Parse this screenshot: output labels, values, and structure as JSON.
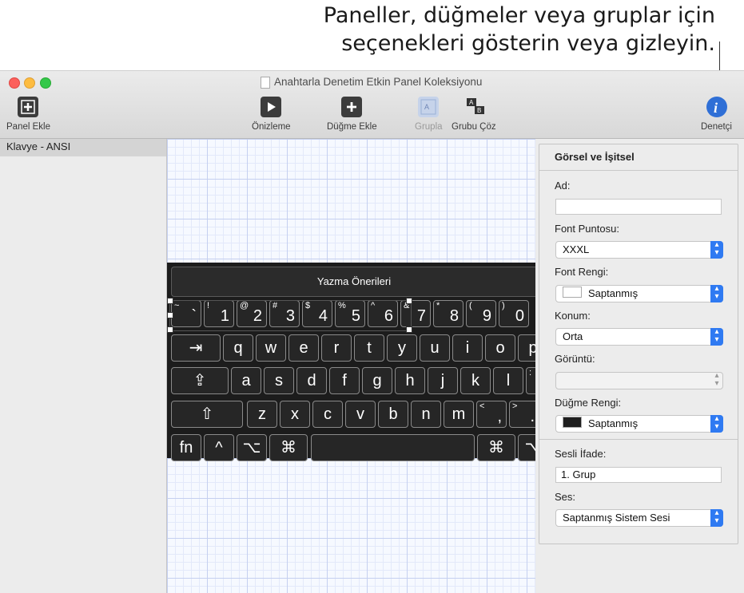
{
  "callout": {
    "line1": "Paneller, düğmeler veya gruplar için",
    "line2": "seçenekleri gösterin veya gizleyin."
  },
  "window": {
    "title": "Anahtarla Denetim Etkin Panel Koleksiyonu"
  },
  "toolbar": {
    "panel_ekle": "Panel Ekle",
    "onizleme": "Önizleme",
    "dugme_ekle": "Düğme Ekle",
    "grupla": "Grupla",
    "grubu_coz": "Grubu Çöz",
    "denetci": "Denetçi"
  },
  "sidebar": {
    "items": [
      "Klavye - ANSI"
    ]
  },
  "keyboard": {
    "prediction": "Yazma Önerileri",
    "keys": [
      {
        "main": "`",
        "sec": "~"
      },
      {
        "main": "1",
        "sec": "!"
      },
      {
        "main": "2",
        "sec": "@"
      },
      {
        "main": "3",
        "sec": "#"
      },
      {
        "main": "4",
        "sec": "$"
      },
      {
        "main": "5",
        "sec": "%"
      },
      {
        "main": "6",
        "sec": "^"
      },
      {
        "main": "7",
        "sec": "&"
      },
      {
        "main": "8",
        "sec": "*"
      },
      {
        "main": "9",
        "sec": "("
      },
      {
        "main": "0",
        "sec": ")"
      },
      {
        "main": "⇥",
        "sec": ""
      },
      {
        "main": "q",
        "sec": ""
      },
      {
        "main": "w",
        "sec": ""
      },
      {
        "main": "e",
        "sec": ""
      },
      {
        "main": "r",
        "sec": ""
      },
      {
        "main": "t",
        "sec": ""
      },
      {
        "main": "y",
        "sec": ""
      },
      {
        "main": "u",
        "sec": ""
      },
      {
        "main": "i",
        "sec": ""
      },
      {
        "main": "o",
        "sec": ""
      },
      {
        "main": "p",
        "sec": ""
      },
      {
        "main": "⇪",
        "sec": ""
      },
      {
        "main": "a",
        "sec": ""
      },
      {
        "main": "s",
        "sec": ""
      },
      {
        "main": "d",
        "sec": ""
      },
      {
        "main": "f",
        "sec": ""
      },
      {
        "main": "g",
        "sec": ""
      },
      {
        "main": "h",
        "sec": ""
      },
      {
        "main": "j",
        "sec": ""
      },
      {
        "main": "k",
        "sec": ""
      },
      {
        "main": "l",
        "sec": ""
      },
      {
        "main": ";",
        "sec": ":"
      },
      {
        "main": "⇧",
        "sec": ""
      },
      {
        "main": "z",
        "sec": ""
      },
      {
        "main": "x",
        "sec": ""
      },
      {
        "main": "c",
        "sec": ""
      },
      {
        "main": "v",
        "sec": ""
      },
      {
        "main": "b",
        "sec": ""
      },
      {
        "main": "n",
        "sec": ""
      },
      {
        "main": "m",
        "sec": ""
      },
      {
        "main": ",",
        "sec": "<"
      },
      {
        "main": ".",
        "sec": ">"
      },
      {
        "main": "fn",
        "sec": ""
      },
      {
        "main": "^",
        "sec": ""
      },
      {
        "main": "⌥",
        "sec": ""
      },
      {
        "main": "⌘",
        "sec": ""
      },
      {
        "main": "",
        "sec": ""
      },
      {
        "main": "⌘",
        "sec": ""
      },
      {
        "main": "⌥",
        "sec": ""
      }
    ]
  },
  "inspector": {
    "title": "Görsel ve İşitsel",
    "ad_label": "Ad:",
    "ad_value": "",
    "font_puntosu_label": "Font Puntosu:",
    "font_puntosu_value": "XXXL",
    "font_rengi_label": "Font Rengi:",
    "font_rengi_value": "Saptanmış",
    "font_rengi_color": "#ffffff",
    "konum_label": "Konum:",
    "konum_value": "Orta",
    "goruntu_label": "Görüntü:",
    "goruntu_value": "",
    "dugme_rengi_label": "Düğme Rengi:",
    "dugme_rengi_value": "Saptanmış",
    "dugme_rengi_color": "#1e1e1e",
    "sesli_ifade_label": "Sesli İfade:",
    "sesli_ifade_value": "1. Grup",
    "ses_label": "Ses:",
    "ses_value": "Saptanmış Sistem Sesi"
  },
  "colors": {
    "accent": "#2f7af2",
    "inspector_icon": "#2f6fd6"
  }
}
